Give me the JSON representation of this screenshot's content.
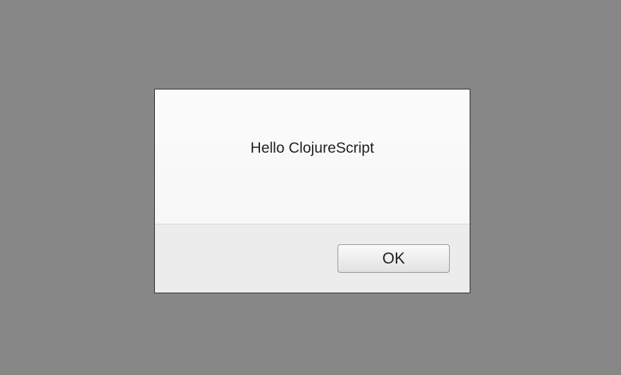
{
  "dialog": {
    "message": "Hello ClojureScript",
    "ok_label": "OK"
  }
}
